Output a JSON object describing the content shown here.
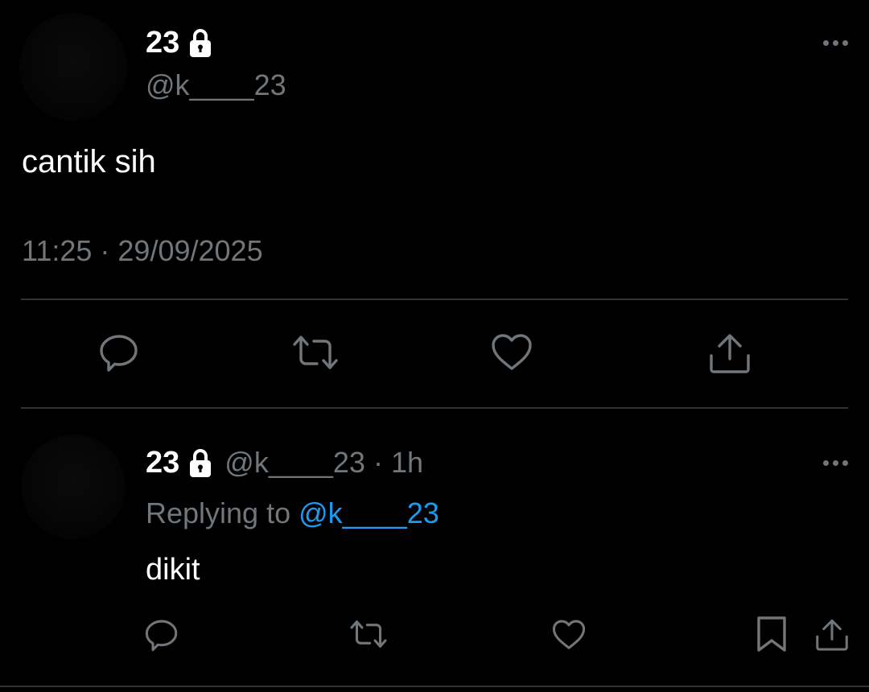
{
  "main_tweet": {
    "display_name": "23",
    "handle": "@k____23",
    "text": "cantik sih",
    "timestamp": "11:25 · 29/09/2025",
    "protected": true,
    "actions": [
      "reply-icon",
      "retweet-icon",
      "like-icon",
      "share-icon"
    ]
  },
  "reply": {
    "display_name": "23",
    "handle_time": "@k____23 · 1h",
    "replying_label": "Replying to ",
    "replying_to": "@k____23",
    "text": "dikit",
    "protected": true,
    "actions": [
      "reply-icon",
      "retweet-icon",
      "like-icon",
      "bookmark-icon",
      "share-icon"
    ]
  },
  "colors": {
    "background": "#000000",
    "primary_text": "#ffffff",
    "secondary_text": "#71767b",
    "divider": "#2f3336",
    "link": "#1d9bf0"
  }
}
